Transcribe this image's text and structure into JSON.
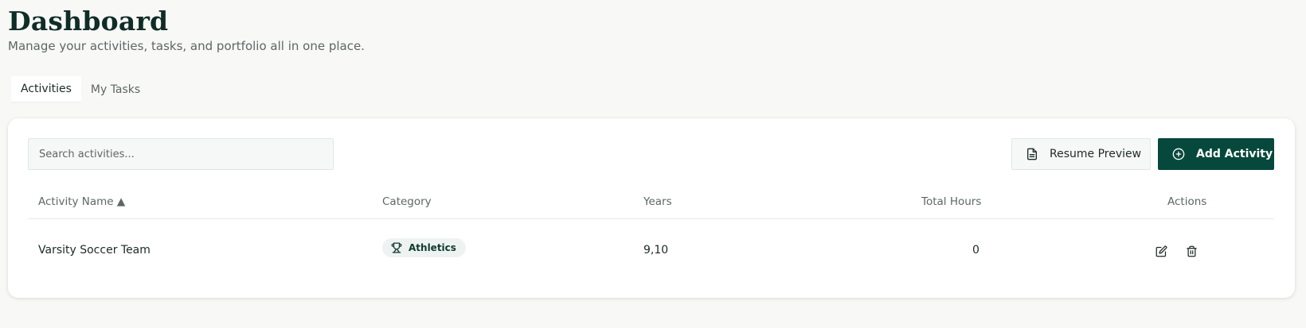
{
  "header": {
    "title": "Dashboard",
    "subtitle": "Manage your activities, tasks, and portfolio all in one place."
  },
  "tabs": [
    {
      "label": "Activities",
      "active": true
    },
    {
      "label": "My Tasks",
      "active": false
    }
  ],
  "toolbar": {
    "search_placeholder": "Search activities...",
    "search_value": "",
    "resume_preview_label": "Resume Preview",
    "resume_preview_icon": "document-icon",
    "add_activity_label": "Add Activity",
    "add_activity_icon": "plus-circle-icon"
  },
  "table": {
    "columns": {
      "activity_name": "Activity Name ▲",
      "category": "Category",
      "years": "Years",
      "total_hours": "Total Hours",
      "actions": "Actions"
    },
    "rows": [
      {
        "activity_name": "Varsity Soccer Team",
        "category": "Athletics",
        "category_icon": "trophy-icon",
        "years": "9,10",
        "total_hours": "0",
        "action_icons": [
          "edit-icon",
          "trash-icon"
        ]
      }
    ]
  },
  "colors": {
    "primary": "#07483c",
    "title": "#0f2d26",
    "muted_text": "#5d6764",
    "background": "#f8f8f7",
    "badge_bg": "#eef3f1"
  }
}
